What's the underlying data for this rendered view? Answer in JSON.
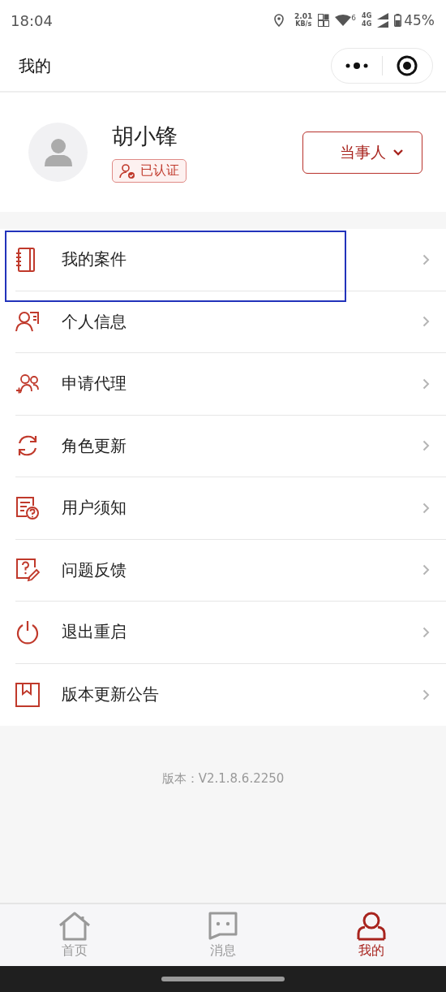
{
  "status_bar": {
    "time": "18:04",
    "speed": "2.01",
    "speed_unit": "KB/s",
    "wifi_badge": "6",
    "network_1": "4G",
    "network_2": "4G",
    "battery": "45%"
  },
  "header": {
    "title": "我的"
  },
  "profile": {
    "name": "胡小锋",
    "badge": "已认证",
    "role": "当事人"
  },
  "menu": [
    {
      "label": "我的案件",
      "selected": true
    },
    {
      "label": "个人信息",
      "selected": false
    },
    {
      "label": "申请代理",
      "selected": false
    },
    {
      "label": "角色更新",
      "selected": false
    },
    {
      "label": "用户须知",
      "selected": false
    },
    {
      "label": "问题反馈",
      "selected": false
    },
    {
      "label": "退出重启",
      "selected": false
    },
    {
      "label": "版本更新公告",
      "selected": false
    }
  ],
  "version": "版本：V2.1.8.6.2250",
  "tabs": [
    {
      "label": "首页",
      "selected": false
    },
    {
      "label": "消息",
      "selected": false
    },
    {
      "label": "我的",
      "selected": true
    }
  ]
}
